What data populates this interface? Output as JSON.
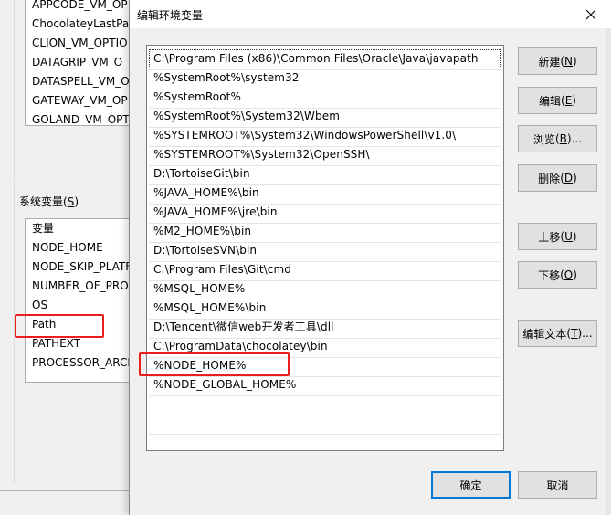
{
  "parent_window": {
    "user_vars_list": [
      "APPCODE_VM_OP",
      "ChocolateyLastPat",
      "CLION_VM_OPTIO",
      "DATAGRIP_VM_O",
      "DATASPELL_VM_O",
      "GATEWAY_VM_OP",
      "GOLAND_VM_OPT"
    ],
    "system_vars_label": "系统变量",
    "system_vars_accel": "(S)",
    "system_vars_header": "变量",
    "system_vars_list": [
      "NODE_HOME",
      "NODE_SKIP_PLATF",
      "NUMBER_OF_PRO",
      "OS",
      "Path",
      "PATHEXT",
      "PROCESSOR_ARCH"
    ]
  },
  "dialog": {
    "title": "编辑环境变量",
    "entries": [
      "C:\\Program Files (x86)\\Common Files\\Oracle\\Java\\javapath",
      "%SystemRoot%\\system32",
      "%SystemRoot%",
      "%SystemRoot%\\System32\\Wbem",
      "%SYSTEMROOT%\\System32\\WindowsPowerShell\\v1.0\\",
      "%SYSTEMROOT%\\System32\\OpenSSH\\",
      "D:\\TortoiseGit\\bin",
      "%JAVA_HOME%\\bin",
      "%JAVA_HOME%\\jre\\bin",
      "%M2_HOME%\\bin",
      "D:\\TortoiseSVN\\bin",
      "C:\\Program Files\\Git\\cmd",
      "%MSQL_HOME%",
      "%MSQL_HOME%\\bin",
      "D:\\Tencent\\微信web开发者工具\\dll",
      "C:\\ProgramData\\chocolatey\\bin",
      "%NODE_HOME%",
      "%NODE_GLOBAL_HOME%"
    ],
    "buttons": {
      "new": {
        "label": "新建",
        "accel": "(N)"
      },
      "edit": {
        "label": "编辑",
        "accel": "(E)"
      },
      "browse": {
        "label": "浏览",
        "accel": "(B)..."
      },
      "delete": {
        "label": "删除",
        "accel": "(D)"
      },
      "move_up": {
        "label": "上移",
        "accel": "(U)"
      },
      "move_down": {
        "label": "下移",
        "accel": "(O)"
      },
      "edit_text": {
        "label": "编辑文本",
        "accel": "(T)..."
      },
      "ok": {
        "label": "确定"
      },
      "cancel": {
        "label": "取消"
      }
    }
  },
  "colors": {
    "highlight_box": "#e8201b",
    "primary_border": "#0078d7"
  },
  "icons": {
    "close": "close-icon"
  }
}
